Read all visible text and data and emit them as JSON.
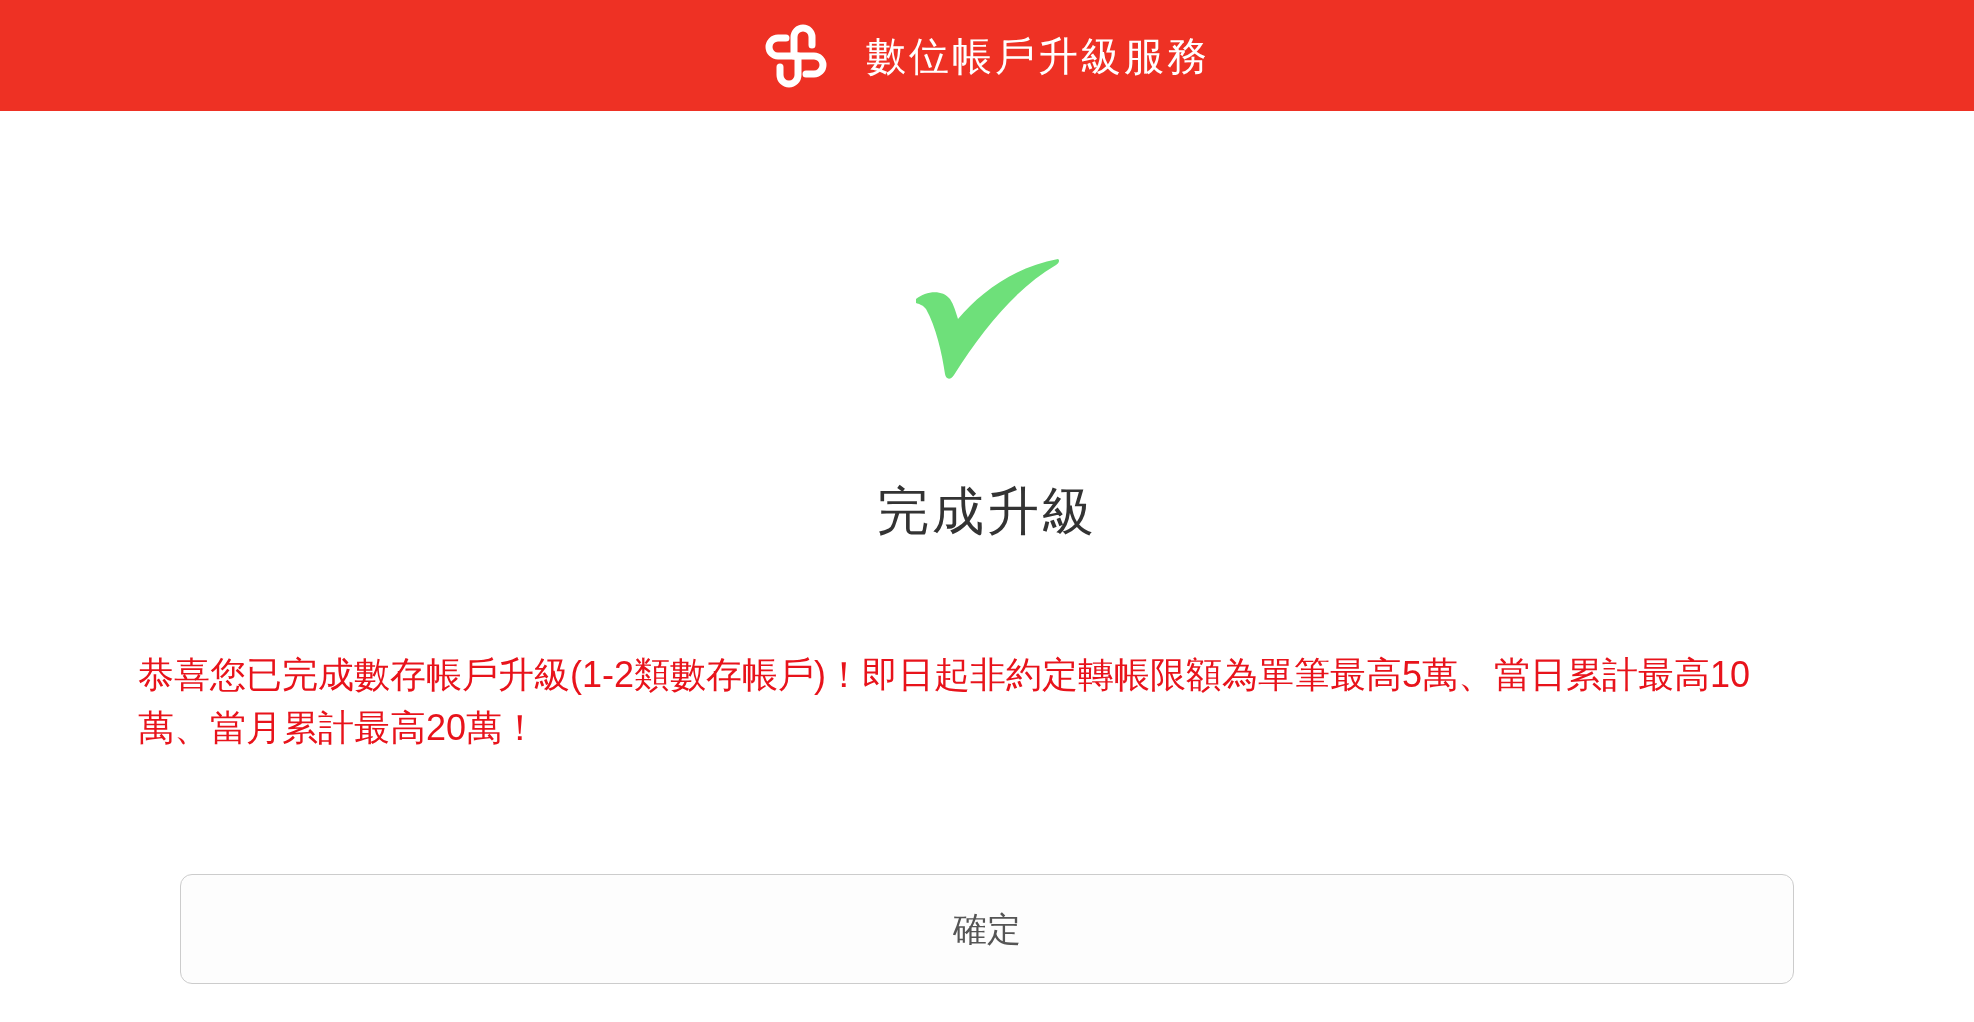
{
  "header": {
    "title": "數位帳戶升級服務"
  },
  "result": {
    "kind": "success",
    "title": "完成升級",
    "message": "恭喜您已完成數存帳戶升級(1-2類數存帳戶)！即日起非約定轉帳限額為單筆最高5萬、當日累計最高10萬、當月累計最高20萬！"
  },
  "buttons": [
    {
      "label": "確定"
    }
  ]
}
